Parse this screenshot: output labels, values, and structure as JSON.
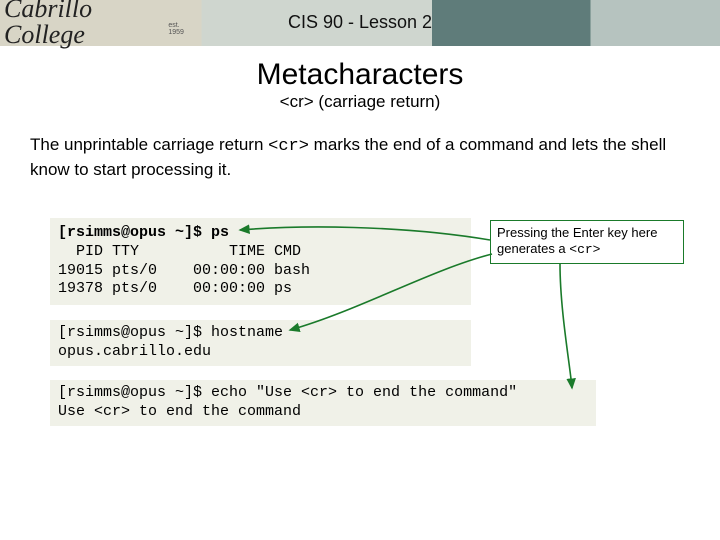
{
  "header": {
    "logo_text": "Cabrillo College",
    "logo_est": "est. 1959",
    "course_title": "CIS 90 - Lesson 2"
  },
  "topic": {
    "title": "Metacharacters",
    "subtitle_prefix": "<cr>",
    "subtitle_paren": " (carriage return)"
  },
  "body": {
    "line1_pre": "The unprintable carriage return ",
    "line1_code": "<cr>",
    "line1_post": " marks the end of a command and lets the shell know to start processing it."
  },
  "terminal1": {
    "l1_prompt": "[rsimms@opus ~]$ ",
    "l1_cmd": "ps",
    "l2": "  PID TTY          TIME CMD",
    "l3": "19015 pts/0    00:00:00 bash",
    "l4": "19378 pts/0    00:00:00 ps"
  },
  "terminal2": {
    "l1_prompt": "[rsimms@opus ~]$ ",
    "l1_cmd": "hostname",
    "l2": "opus.cabrillo.edu"
  },
  "terminal3": {
    "l1_prompt": "[rsimms@opus ~]$ ",
    "l1_cmd": "echo \"Use <cr> to end the command\"",
    "l2": "Use <cr> to end the command"
  },
  "callout": {
    "text_pre": "Pressing the Enter key here generates a ",
    "text_code": "<cr>"
  }
}
